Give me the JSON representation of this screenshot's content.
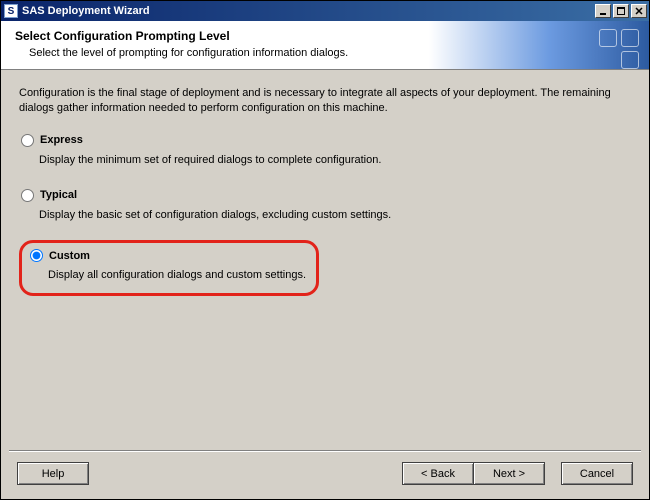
{
  "window": {
    "title": "SAS Deployment Wizard",
    "icon_letter": "S"
  },
  "header": {
    "title": "Select Configuration Prompting Level",
    "subtitle": "Select the level of prompting for configuration information dialogs."
  },
  "intro": "Configuration is the final stage of deployment and is necessary to integrate all aspects of your deployment.  The remaining dialogs gather information needed to perform configuration on this machine.",
  "options": [
    {
      "id": "express",
      "label": "Express",
      "desc": "Display the minimum set of required dialogs to complete configuration.",
      "selected": false,
      "highlighted": false
    },
    {
      "id": "typical",
      "label": "Typical",
      "desc": "Display the basic set of configuration dialogs, excluding custom settings.",
      "selected": false,
      "highlighted": false
    },
    {
      "id": "custom",
      "label": "Custom",
      "desc": "Display all configuration dialogs and custom settings.",
      "selected": true,
      "highlighted": true
    }
  ],
  "buttons": {
    "help": "Help",
    "back": "< Back",
    "next": "Next >",
    "cancel": "Cancel"
  }
}
